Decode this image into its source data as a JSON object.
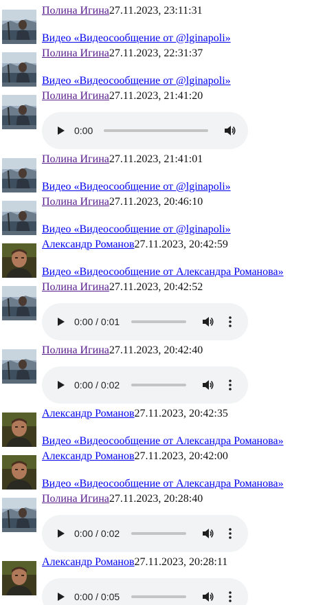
{
  "colors": {
    "visited_link": "#551a8b",
    "link": "#0000ee",
    "player_background": "#f1f3f4"
  },
  "messages": [
    {
      "author": "Полина Игина",
      "author_state": "visited",
      "avatar": "polina",
      "timestamp": "27.11.2023, 23:11:31",
      "type": "video",
      "link": "Видео «Видеосообщение от @lginapoli»"
    },
    {
      "author": "Полина Игина",
      "author_state": "visited",
      "avatar": "polina",
      "timestamp": "27.11.2023, 22:31:37",
      "type": "video",
      "link": "Видео «Видеосообщение от @lginapoli»"
    },
    {
      "author": "Полина Игина",
      "author_state": "visited",
      "avatar": "polina",
      "timestamp": "27.11.2023, 21:41:20",
      "type": "audio",
      "player_time": "0:00",
      "has_menu": false
    },
    {
      "author": "Полина Игина",
      "author_state": "visited",
      "avatar": "polina",
      "timestamp": "27.11.2023, 21:41:01",
      "type": "video",
      "link": "Видео «Видеосообщение от @lginapoli»"
    },
    {
      "author": "Полина Игина",
      "author_state": "visited",
      "avatar": "polina",
      "timestamp": "27.11.2023, 20:46:10",
      "type": "video",
      "link": "Видео «Видеосообщение от @lginapoli»"
    },
    {
      "author": "Александр Романов",
      "author_state": "fresh",
      "avatar": "alexander",
      "timestamp": "27.11.2023, 20:42:59",
      "type": "video",
      "link": "Видео «Видеосообщение от Александра Романова»"
    },
    {
      "author": "Полина Игина",
      "author_state": "visited",
      "avatar": "polina",
      "timestamp": "27.11.2023, 20:42:52",
      "type": "audio",
      "player_time": "0:00 / 0:01",
      "has_menu": true
    },
    {
      "author": "Полина Игина",
      "author_state": "visited",
      "avatar": "polina",
      "timestamp": "27.11.2023, 20:42:40",
      "type": "audio",
      "player_time": "0:00 / 0:02",
      "has_menu": true
    },
    {
      "author": "Александр Романов",
      "author_state": "fresh",
      "avatar": "alexander",
      "timestamp": "27.11.2023, 20:42:35",
      "type": "video",
      "link": "Видео «Видеосообщение от Александра Романова»"
    },
    {
      "author": "Александр Романов",
      "author_state": "fresh",
      "avatar": "alexander",
      "timestamp": "27.11.2023, 20:42:00",
      "type": "video",
      "link": "Видео «Видеосообщение от Александра Романова»"
    },
    {
      "author": "Полина Игина",
      "author_state": "visited",
      "avatar": "polina",
      "timestamp": "27.11.2023, 20:28:40",
      "type": "audio",
      "player_time": "0:00 / 0:02",
      "has_menu": true
    },
    {
      "author": "Александр Романов",
      "author_state": "fresh",
      "avatar": "alexander",
      "timestamp": "27.11.2023, 20:28:11",
      "type": "audio",
      "player_time": "0:00 / 0:05",
      "has_menu": true
    }
  ]
}
